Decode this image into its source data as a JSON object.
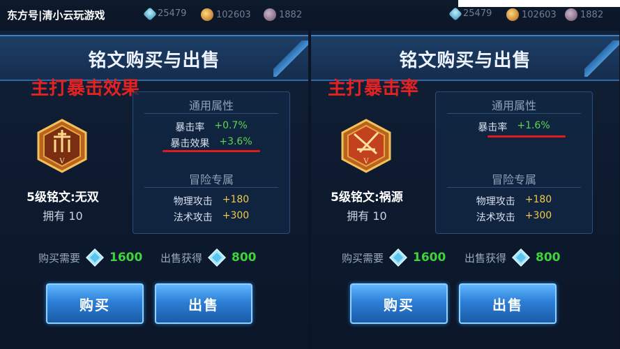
{
  "watermark": "东方号|清小云玩游戏",
  "resources": [
    {
      "icon": "gem-icon",
      "value": "25479"
    },
    {
      "icon": "gold-coin-icon",
      "value": "102603"
    },
    {
      "icon": "skull-icon",
      "value": "1882"
    }
  ],
  "panels": [
    {
      "title": "铭文购买与出售",
      "highlight": "主打暴击效果",
      "rune_name": "5级铭文:无双",
      "owned": "拥有 10",
      "general_title": "通用属性",
      "general": [
        {
          "key": "暴击率",
          "value": "+0.7%"
        },
        {
          "key": "暴击效果",
          "value": "+3.6%"
        }
      ],
      "adventure_title": "冒险专属",
      "adventure": [
        {
          "key": "物理攻击",
          "value": "+180"
        },
        {
          "key": "法术攻击",
          "value": "+300"
        }
      ],
      "buy_cost_label": "购买需要",
      "buy_cost": "1600",
      "sell_gain_label": "出售获得",
      "sell_gain": "800",
      "buy_button": "购买",
      "sell_button": "出售"
    },
    {
      "title": "铭文购买与出售",
      "highlight": "主打暴击率",
      "rune_name": "5级铭文:祸源",
      "owned": "拥有 10",
      "general_title": "通用属性",
      "general": [
        {
          "key": "暴击率",
          "value": "+1.6%"
        }
      ],
      "adventure_title": "冒险专属",
      "adventure": [
        {
          "key": "物理攻击",
          "value": "+180"
        },
        {
          "key": "法术攻击",
          "value": "+300"
        }
      ],
      "buy_cost_label": "购买需要",
      "buy_cost": "1600",
      "sell_gain_label": "出售获得",
      "sell_gain": "800",
      "buy_button": "购买",
      "sell_button": "出售"
    }
  ],
  "colors": {
    "highlight_red": "#e52222",
    "stat_green": "#5cd64e",
    "stat_yellow": "#f0c94d",
    "price_green": "#3fd33c"
  }
}
